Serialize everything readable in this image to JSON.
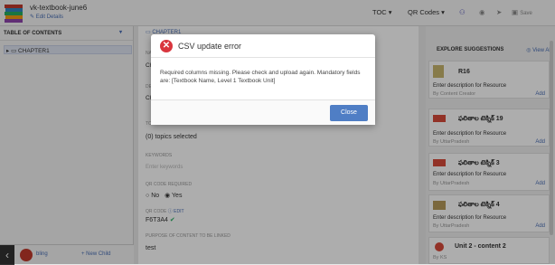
{
  "header": {
    "title": "vk-textbook-june6",
    "edit_details": "Edit Details",
    "toc": "TOC",
    "qr_codes": "QR Codes",
    "save": "Save"
  },
  "sidebar": {
    "heading": "TABLE OF CONTENTS",
    "chapter": "CHAPTER1",
    "bottom_left": "bling",
    "new_child": "+ New Child"
  },
  "main": {
    "breadcrumb": "CHAPTER1",
    "na_prefix": "NA",
    "ch_prefix1": "Ch",
    "de_prefix": "DE",
    "ch_prefix2": "Ch",
    "to_prefix": "TO",
    "topics_selected": "(0) topics selected",
    "keywords_label": "KEYWORDS",
    "keywords_placeholder": "Enter keywords",
    "qr_required_label": "QR CODE REQUIRED",
    "no_label": "No",
    "yes_label": "Yes",
    "qr_code_label": "QR CODE",
    "edit_label": "EDIT",
    "qr_code_value": "F6T3A4",
    "purpose_label": "PURPOSE OF CONTENT TO BE LINKED",
    "purpose_value": "test"
  },
  "explore": {
    "heading": "EXPLORE SUGGESTIONS",
    "view_all": "View All",
    "add_label": "Add",
    "cards": [
      {
        "title": "R16",
        "desc": "Enter description for Resource",
        "by": "By Content Creator"
      },
      {
        "title": "ఫలితాల టెక్నిక్ 19",
        "desc": "Enter description for Resource",
        "by": "By UttarPradesh"
      },
      {
        "title": "ఫలితాల టెక్నిక్ 3",
        "desc": "Enter description for Resource",
        "by": "By UttarPradesh"
      },
      {
        "title": "ఫలితాల టెక్నిక్ 4",
        "desc": "Enter description for Resource",
        "by": "By UttarPradesh"
      },
      {
        "title": "Unit 2 - content 2",
        "desc": "",
        "by": "By KS"
      }
    ]
  },
  "modal": {
    "title": "CSV update error",
    "body": "Required columns missing. Please check and upload again. Mandatory fields are: [Textbook Name, Level 1 Textbook Unit]",
    "close_label": "Close"
  },
  "colors": {
    "accent": "#4f7ec5",
    "error": "#d9363e",
    "link": "#4a6fb5"
  },
  "icons": [
    "error-icon",
    "book-logo-icon",
    "check-icon",
    "folder-icon",
    "chevron-down-icon"
  ]
}
